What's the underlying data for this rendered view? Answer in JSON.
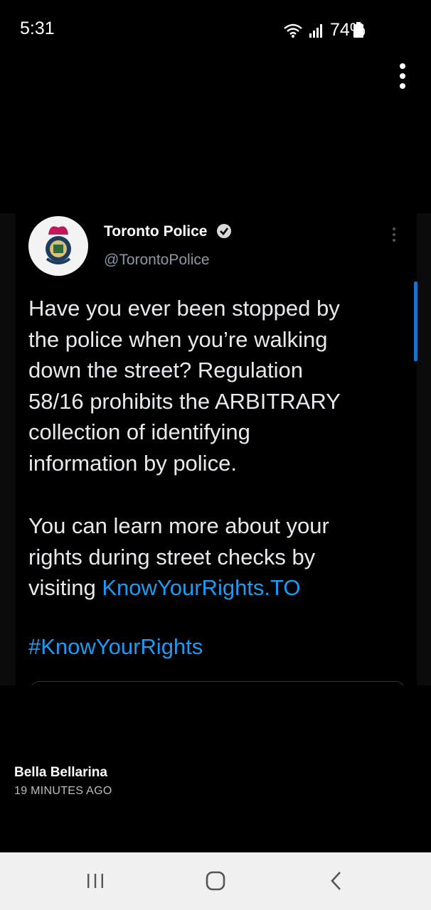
{
  "status_bar": {
    "time": "5:31",
    "battery": "74%"
  },
  "tweet": {
    "author_name": "Toronto Police",
    "handle": "@TorontoPolice",
    "para1": "Have you ever been stopped by\nthe police when you’re walking\ndown the street?  Regulation\n58/16 prohibits the ARBITRARY\ncollection of identifying\ninformation by police.",
    "para2_line1": "You can learn more about your",
    "para2_line2": "rights during street checks by",
    "para2_prefix": "visiting ",
    "link": "KnowYourRights.TO",
    "hashtag": "#KnowYourRights"
  },
  "story": {
    "author": "Bella Bellarina",
    "time_ago": "19 MINUTES AGO"
  },
  "colors": {
    "link": "#1d9bf0",
    "background": "#000000",
    "nav_bar": "#f0f0f0"
  }
}
